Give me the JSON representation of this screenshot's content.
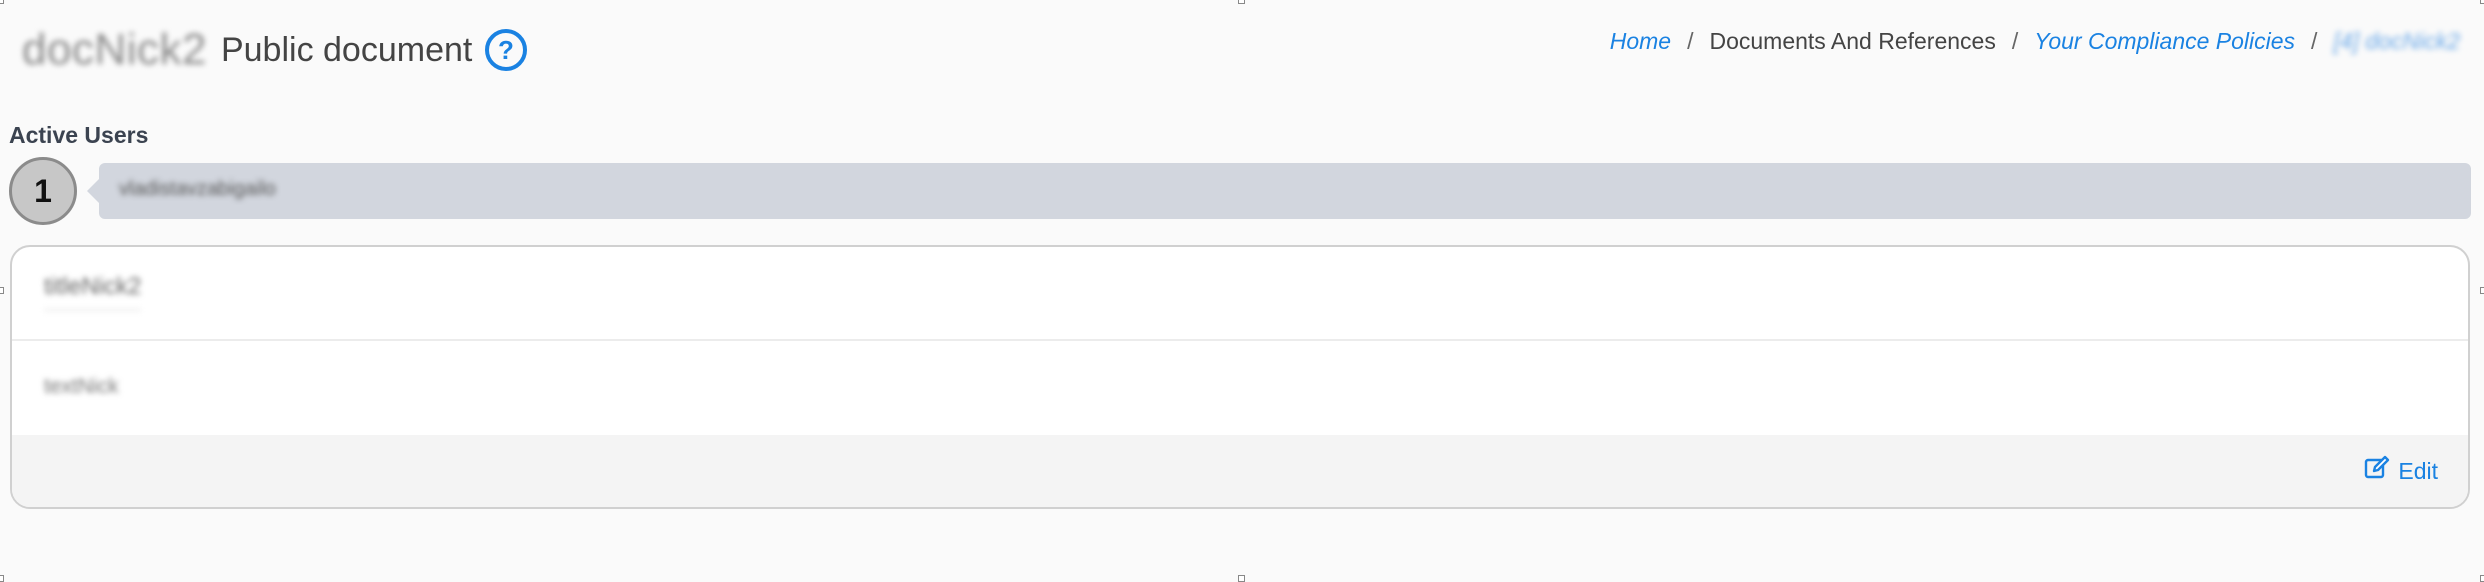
{
  "header": {
    "doc_name": "docNick2",
    "subtitle": "Public document",
    "help_icon": "question-circle-icon"
  },
  "breadcrumb": {
    "items": [
      {
        "label": "Home",
        "link": true
      },
      {
        "label": "Documents And References",
        "link": false
      },
      {
        "label": "Your Compliance Policies",
        "link": true
      },
      {
        "label": "[4] docNick2",
        "link": true
      }
    ],
    "separator": "/"
  },
  "active_users": {
    "label": "Active Users",
    "count": "1",
    "users": [
      "vladistavzabigailo"
    ]
  },
  "card": {
    "title": "titleNick2",
    "body": "textNick",
    "edit_label": "Edit",
    "edit_icon": "edit-icon"
  },
  "colors": {
    "accent": "#1a82e2",
    "bubble": "#d2d6de",
    "badge": "#c7c7c7"
  }
}
